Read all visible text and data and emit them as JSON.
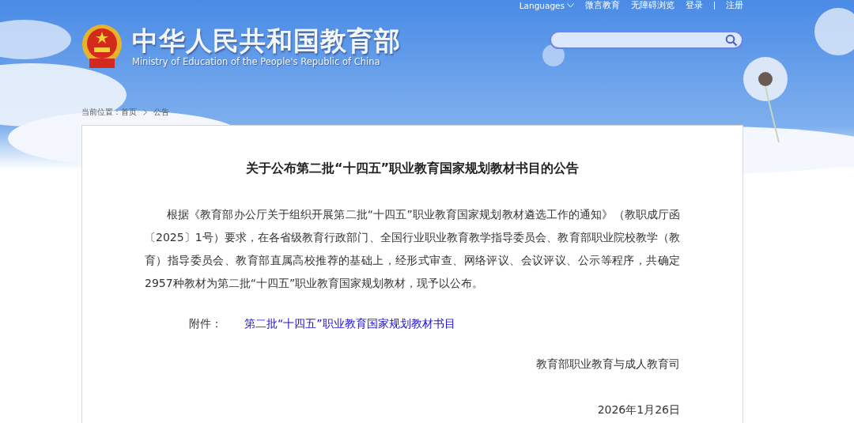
{
  "top_links": [
    {
      "label": "Languages",
      "kind": "dropdown"
    },
    {
      "label": "微言教育",
      "kind": "link"
    },
    {
      "label": "无障碍浏览",
      "kind": "link"
    },
    {
      "label": "登录",
      "kind": "link"
    },
    {
      "label": "注册",
      "kind": "link"
    }
  ],
  "site": {
    "title": "中华人民共和国教育部",
    "subtitle": "Ministry of Education of the People's Republic of China"
  },
  "breadcrumb": {
    "prefix": "当前位置：",
    "items": [
      "首页",
      "公告"
    ]
  },
  "article": {
    "title": "关于公布第二批“十四五”职业教育国家规划教材书目的公告",
    "body": "根据《教育部办公厅关于组织开展第二批“十四五”职业教育国家规划教材遴选工作的通知》（教职成厅函〔2025〕1号）要求，在各省级教育行政部门、全国行业职业教育教学指导委员会、教育部职业院校教学（教育）指导委员会、教育部直属高校推荐的基础上，经形式审查、网络评议、会议评议、公示等程序，共确定2957种教材为第二批“十四五”职业教育国家规划教材，现予以公布。",
    "attachment_label": "附件：",
    "attachment_link": "第二批“十四五”职业教育国家规划教材书目",
    "issuer": "教育部职业教育与成人教育司",
    "date": "2026年1月26日"
  }
}
